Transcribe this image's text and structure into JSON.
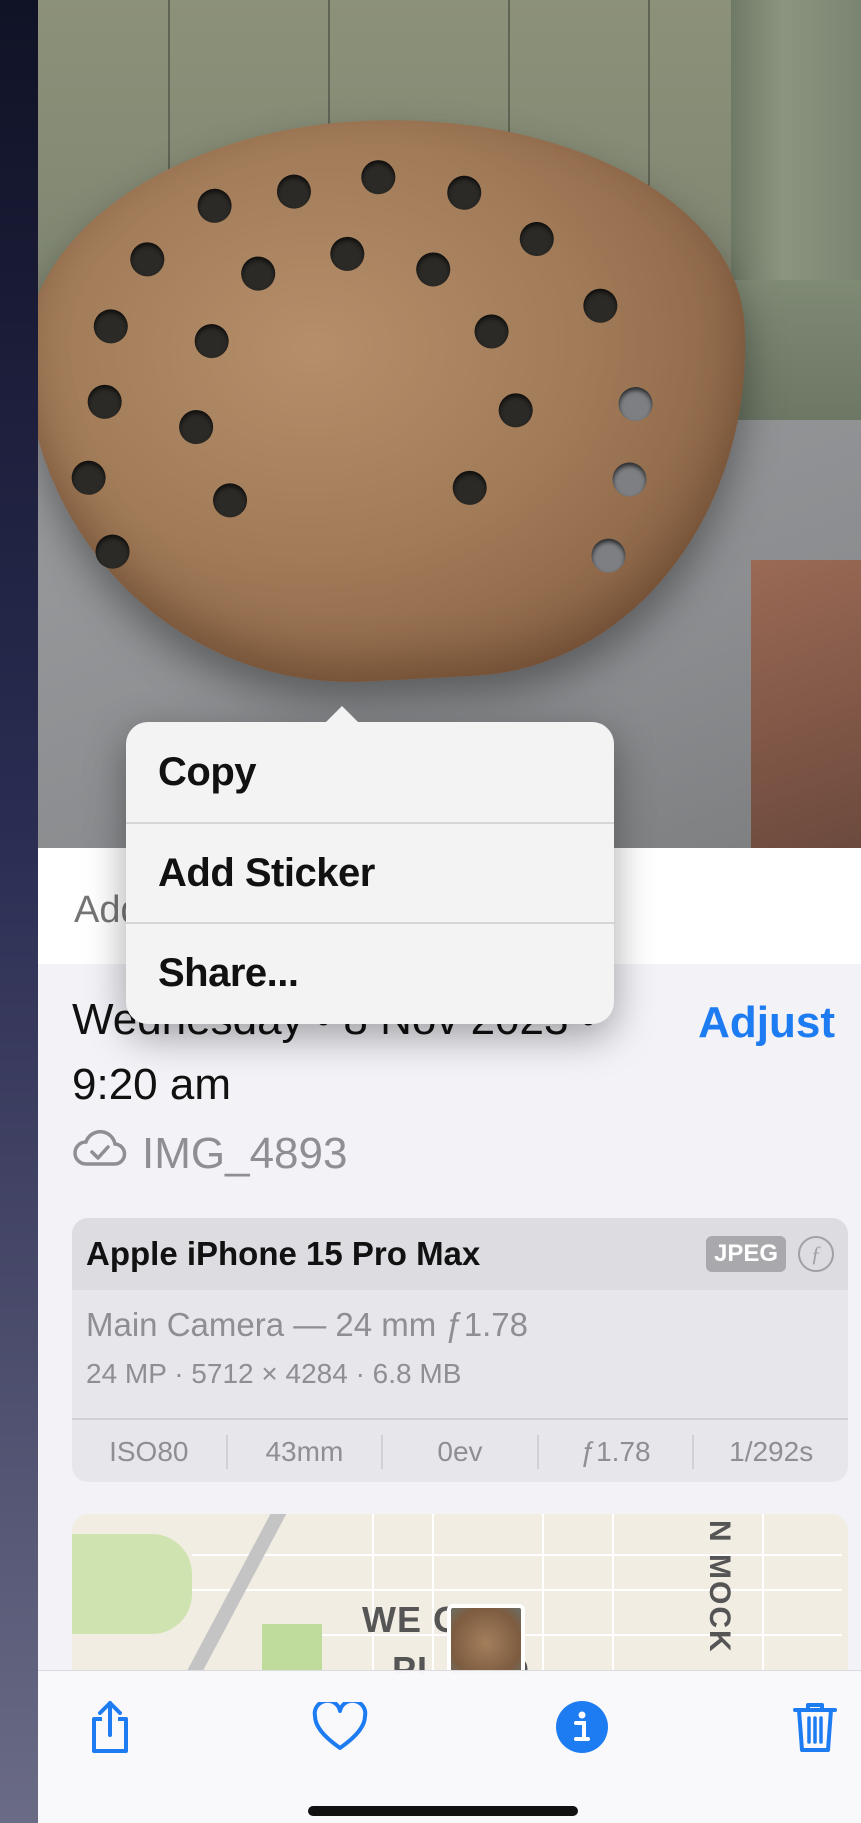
{
  "photo": {
    "description_icon": "tractor-seat-photo"
  },
  "popup_menu": {
    "items": [
      {
        "label": "Copy"
      },
      {
        "label": "Add Sticker"
      },
      {
        "label": "Share..."
      }
    ]
  },
  "caption": {
    "placeholder": "Add a Caption"
  },
  "info": {
    "date": "Wednesday • 8 Nov 2023 •",
    "time": "9:20 am",
    "adjust_label": "Adjust",
    "filename": "IMG_4893",
    "cloud_icon": "cloud-check-icon"
  },
  "camera_card": {
    "device": "Apple iPhone 15 Pro Max",
    "format_badge": "JPEG",
    "lens": "Main Camera — 24 mm ƒ1.78",
    "specs": "24 MP · 5712 × 4284 · 6.8 MB",
    "stats": [
      "ISO80",
      "43mm",
      "0ev",
      "ƒ1.78",
      "1/292s"
    ]
  },
  "map": {
    "label_line1": "WE   OOD",
    "label_line2": "PL   AND",
    "street_vertical": "N MOCK"
  },
  "toolbar": {
    "share_icon": "share-icon",
    "favorite_icon": "heart-icon",
    "info_icon": "info-icon",
    "delete_icon": "trash-icon"
  },
  "colors": {
    "accent": "#1e7cf2",
    "background": "#f2f2f7"
  }
}
